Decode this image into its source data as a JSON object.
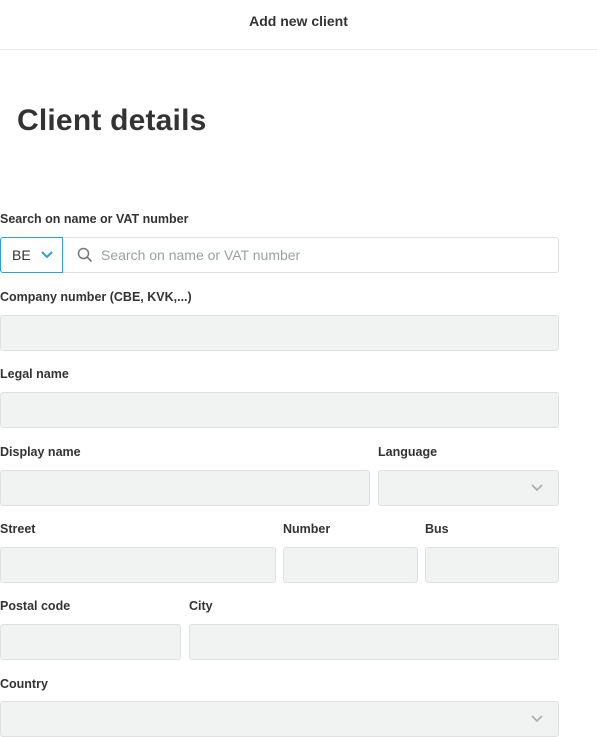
{
  "header": {
    "title": "Add new client"
  },
  "page": {
    "title": "Client details"
  },
  "search": {
    "label": "Search on name or VAT number",
    "country_code": "BE",
    "placeholder": "Search on name or VAT number",
    "value": ""
  },
  "fields": {
    "company_number": {
      "label": "Company number (CBE, KVK,...)",
      "value": ""
    },
    "legal_name": {
      "label": "Legal name",
      "value": ""
    },
    "display_name": {
      "label": "Display name",
      "value": ""
    },
    "language": {
      "label": "Language",
      "value": ""
    },
    "street": {
      "label": "Street",
      "value": ""
    },
    "number": {
      "label": "Number",
      "value": ""
    },
    "bus": {
      "label": "Bus",
      "value": ""
    },
    "postal_code": {
      "label": "Postal code",
      "value": ""
    },
    "city": {
      "label": "City",
      "value": ""
    },
    "country": {
      "label": "Country",
      "value": ""
    }
  },
  "colors": {
    "accent": "#2d9fd8",
    "field_bg": "#f1f2f2",
    "field_border": "#dfe1e1",
    "text": "#333333",
    "placeholder": "#9aa0a0"
  },
  "icons": {
    "search": "search-icon",
    "dropdown": "chevron-down-icon"
  }
}
